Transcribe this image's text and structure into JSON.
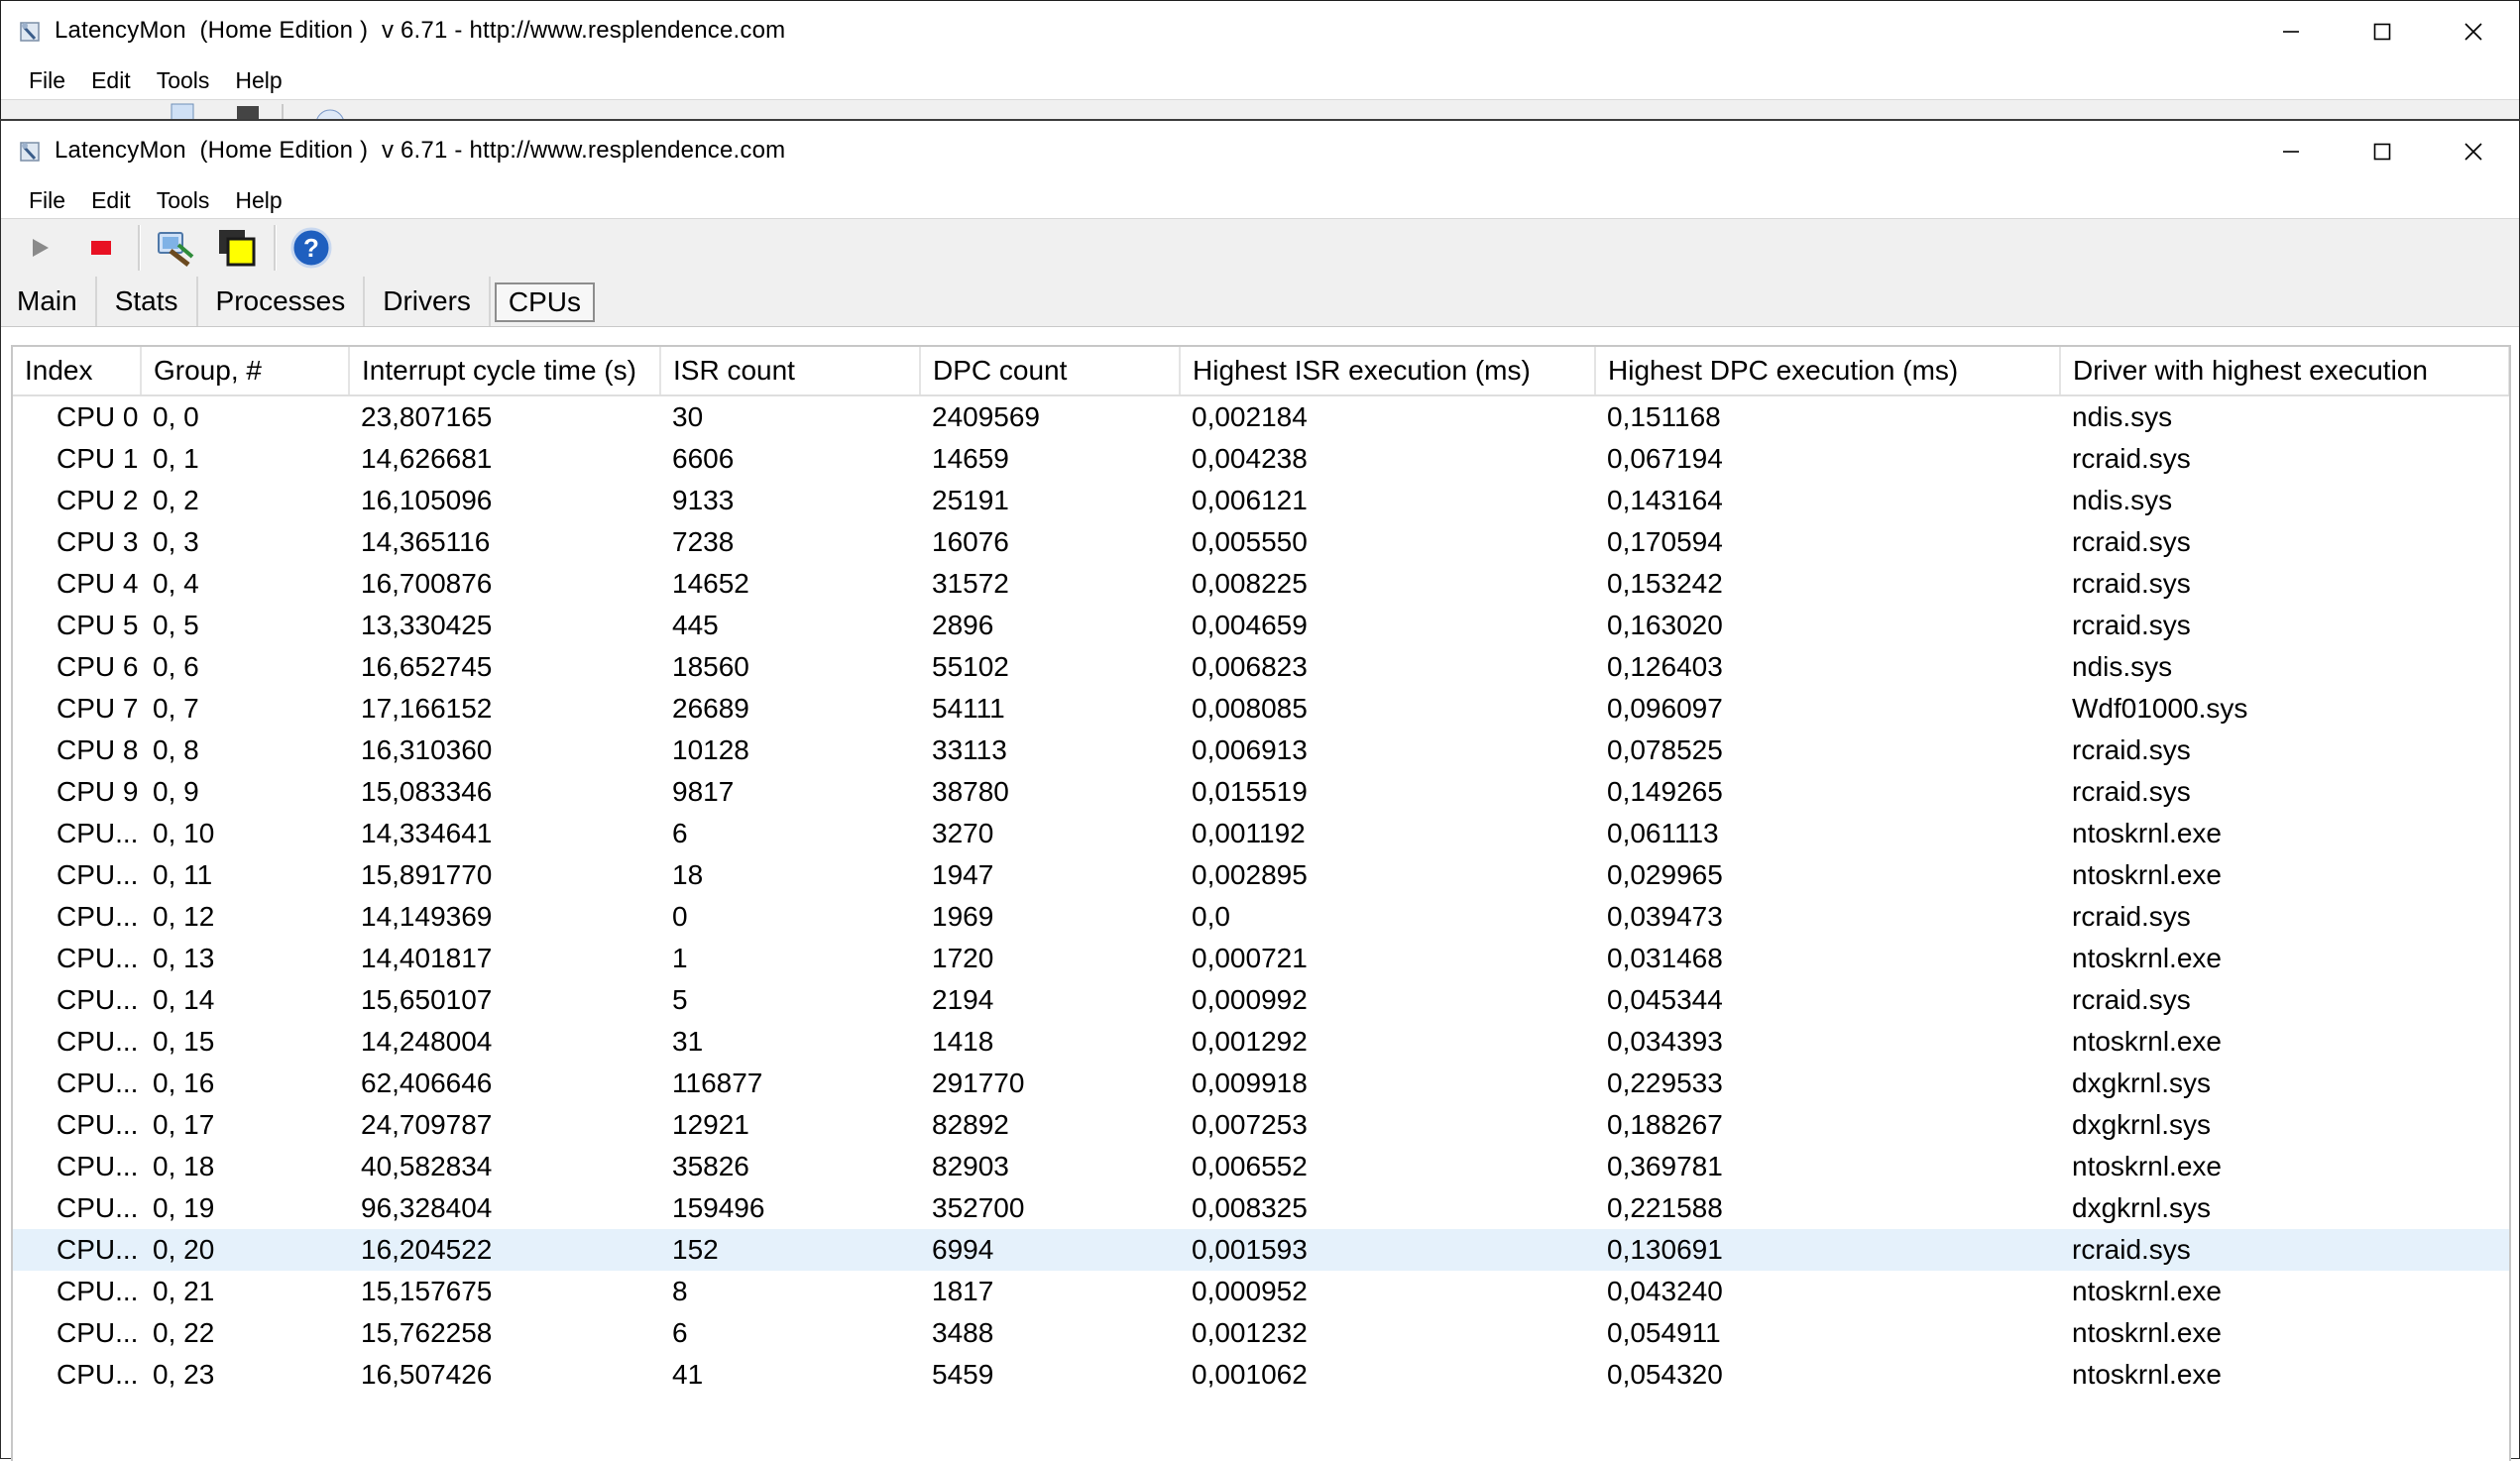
{
  "back_window": {
    "title": "LatencyMon  (Home Edition )  v 6.71 - http://www.resplendence.com",
    "menu": [
      "File",
      "Edit",
      "Tools",
      "Help"
    ]
  },
  "window": {
    "title": "LatencyMon  (Home Edition )  v 6.71 - http://www.resplendence.com",
    "menu": [
      "File",
      "Edit",
      "Tools",
      "Help"
    ],
    "toolbar": [
      "play-icon",
      "stop-icon",
      "driver-tool-icon",
      "windows-icon",
      "help-icon"
    ],
    "tabs": [
      "Main",
      "Stats",
      "Processes",
      "Drivers",
      "CPUs"
    ],
    "active_tab": "CPUs"
  },
  "table": {
    "columns": [
      "Index",
      "Group, #",
      "Interrupt cycle time (s)",
      "ISR count",
      "DPC count",
      "Highest ISR execution (ms)",
      "Highest DPC execution (ms)",
      "Driver with highest execution"
    ],
    "selected_row": 20,
    "rows": [
      [
        "CPU 0",
        "0, 0",
        "23,807165",
        "30",
        "2409569",
        "0,002184",
        "0,151168",
        "ndis.sys"
      ],
      [
        "CPU 1",
        "0, 1",
        "14,626681",
        "6606",
        "14659",
        "0,004238",
        "0,067194",
        "rcraid.sys"
      ],
      [
        "CPU 2",
        "0, 2",
        "16,105096",
        "9133",
        "25191",
        "0,006121",
        "0,143164",
        "ndis.sys"
      ],
      [
        "CPU 3",
        "0, 3",
        "14,365116",
        "7238",
        "16076",
        "0,005550",
        "0,170594",
        "rcraid.sys"
      ],
      [
        "CPU 4",
        "0, 4",
        "16,700876",
        "14652",
        "31572",
        "0,008225",
        "0,153242",
        "rcraid.sys"
      ],
      [
        "CPU 5",
        "0, 5",
        "13,330425",
        "445",
        "2896",
        "0,004659",
        "0,163020",
        "rcraid.sys"
      ],
      [
        "CPU 6",
        "0, 6",
        "16,652745",
        "18560",
        "55102",
        "0,006823",
        "0,126403",
        "ndis.sys"
      ],
      [
        "CPU 7",
        "0, 7",
        "17,166152",
        "26689",
        "54111",
        "0,008085",
        "0,096097",
        "Wdf01000.sys"
      ],
      [
        "CPU 8",
        "0, 8",
        "16,310360",
        "10128",
        "33113",
        "0,006913",
        "0,078525",
        "rcraid.sys"
      ],
      [
        "CPU 9",
        "0, 9",
        "15,083346",
        "9817",
        "38780",
        "0,015519",
        "0,149265",
        "rcraid.sys"
      ],
      [
        "CPU...",
        "0, 10",
        "14,334641",
        "6",
        "3270",
        "0,001192",
        "0,061113",
        "ntoskrnl.exe"
      ],
      [
        "CPU...",
        "0, 11",
        "15,891770",
        "18",
        "1947",
        "0,002895",
        "0,029965",
        "ntoskrnl.exe"
      ],
      [
        "CPU...",
        "0, 12",
        "14,149369",
        "0",
        "1969",
        "0,0",
        "0,039473",
        "rcraid.sys"
      ],
      [
        "CPU...",
        "0, 13",
        "14,401817",
        "1",
        "1720",
        "0,000721",
        "0,031468",
        "ntoskrnl.exe"
      ],
      [
        "CPU...",
        "0, 14",
        "15,650107",
        "5",
        "2194",
        "0,000992",
        "0,045344",
        "rcraid.sys"
      ],
      [
        "CPU...",
        "0, 15",
        "14,248004",
        "31",
        "1418",
        "0,001292",
        "0,034393",
        "ntoskrnl.exe"
      ],
      [
        "CPU...",
        "0, 16",
        "62,406646",
        "116877",
        "291770",
        "0,009918",
        "0,229533",
        "dxgkrnl.sys"
      ],
      [
        "CPU...",
        "0, 17",
        "24,709787",
        "12921",
        "82892",
        "0,007253",
        "0,188267",
        "dxgkrnl.sys"
      ],
      [
        "CPU...",
        "0, 18",
        "40,582834",
        "35826",
        "82903",
        "0,006552",
        "0,369781",
        "ntoskrnl.exe"
      ],
      [
        "CPU...",
        "0, 19",
        "96,328404",
        "159496",
        "352700",
        "0,008325",
        "0,221588",
        "dxgkrnl.sys"
      ],
      [
        "CPU...",
        "0, 20",
        "16,204522",
        "152",
        "6994",
        "0,001593",
        "0,130691",
        "rcraid.sys"
      ],
      [
        "CPU...",
        "0, 21",
        "15,157675",
        "8",
        "1817",
        "0,000952",
        "0,043240",
        "ntoskrnl.exe"
      ],
      [
        "CPU...",
        "0, 22",
        "15,762258",
        "6",
        "3488",
        "0,001232",
        "0,054911",
        "ntoskrnl.exe"
      ],
      [
        "CPU...",
        "0, 23",
        "16,507426",
        "41",
        "5459",
        "0,001062",
        "0,054320",
        "ntoskrnl.exe"
      ]
    ]
  },
  "colors": {
    "selection": "#e5f1fb",
    "stop_red": "#e81123",
    "help_blue": "#1f5fbf",
    "toolbar_bg": "#f0f0f0"
  }
}
